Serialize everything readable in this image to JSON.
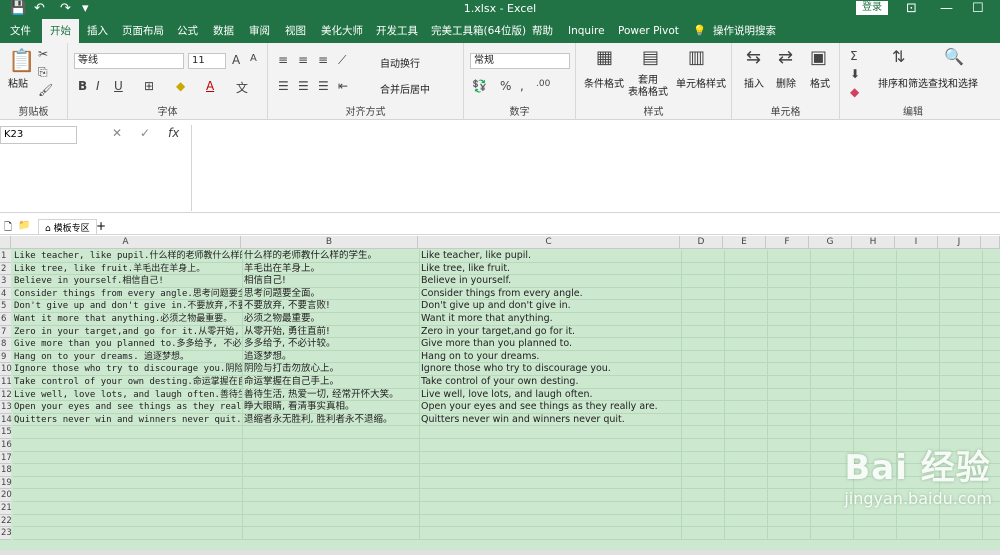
{
  "titlebar": {
    "title": "1.xlsx  -  Excel",
    "login": "登录"
  },
  "tabs": [
    "文件",
    "开始",
    "插入",
    "页面布局",
    "公式",
    "数据",
    "审阅",
    "视图",
    "美化大师",
    "开发工具",
    "完美工具箱(64位版)",
    "帮助",
    "Inquire",
    "Power Pivot",
    "操作说明搜索"
  ],
  "ribbon": {
    "clipboard": {
      "paste": "粘贴",
      "label": "剪贴板"
    },
    "font": {
      "name": "等线",
      "size": "11",
      "bold": "B",
      "italic": "I",
      "underline": "U",
      "label": "字体"
    },
    "align": {
      "wrap": "自动换行",
      "merge": "合并后居中",
      "label": "对齐方式"
    },
    "number": {
      "format": "常规",
      "label": "数字"
    },
    "styles": {
      "cond": "条件格式",
      "table": "套用\n表格格式",
      "cellstyle": "单元格样式",
      "label": "样式"
    },
    "cells": {
      "insert": "插入",
      "delete": "删除",
      "format": "格式",
      "label": "单元格"
    },
    "edit": {
      "sort": "排序和筛选",
      "find": "查找和选择",
      "label": "编辑"
    }
  },
  "formula_bar": {
    "namebox": "K23",
    "fx": "fx",
    "value": ""
  },
  "doc_tabs": {
    "template": "模板专区",
    "add": "+"
  },
  "columns": [
    "A",
    "B",
    "C",
    "D",
    "E",
    "F",
    "G",
    "H",
    "I",
    "J"
  ],
  "rows": [
    [
      "Like teacher, like pupil.什么样的老师教什么样的",
      "什么样的老师教什么样的学生。",
      "Like teacher, like pupil."
    ],
    [
      "Like tree, like fruit.羊毛出在羊身上。",
      "羊毛出在羊身上。",
      "Like tree, like fruit."
    ],
    [
      "Believe in yourself.相信自己!",
      "相信自己!",
      "Believe in yourself."
    ],
    [
      "Consider things from every angle.思考问题要全面",
      "思考问题要全面。",
      "Consider things from every angle."
    ],
    [
      "Don't give up and don't give in.不要放弃,不要",
      "不要放弃, 不要言败!",
      "Don't give up and don't give in."
    ],
    [
      "Want it more that anything.必须之物最重要。",
      "必须之物最重要。",
      "Want it more that anything."
    ],
    [
      "Zero in your target,and go for it.从零开始, 勇",
      "从零开始, 勇往直前!",
      "Zero in your target,and go for it."
    ],
    [
      "Give more than you planned to.多多给予, 不必计",
      "多多给予, 不必计较。",
      "Give more than you planned to."
    ],
    [
      "Hang on to your dreams. 追逐梦想。",
      " 追逐梦想。",
      "Hang on to your dreams."
    ],
    [
      "Ignore those who try to discourage you.阴险与",
      "阴险与打击勿放心上。",
      "Ignore those who try to discourage you."
    ],
    [
      "Take control of your own desting.命运掌握在自",
      "命运掌握在自己手上。",
      "Take control of your own desting."
    ],
    [
      "Live well, love lots, and laugh often.善待生活",
      "善待生活, 热爱一切, 经常开怀大笑。",
      "Live well, love lots, and laugh often."
    ],
    [
      "Open your eyes and see things as they really",
      "睁大眼睛, 看清事实真相。",
      "Open your eyes and see things as they really are."
    ],
    [
      "Quitters never win and winners never quit.退缩",
      "退缩者永无胜利, 胜利者永不退缩。",
      "Quitters never win and winners never quit."
    ]
  ],
  "row_count": 23,
  "watermark": {
    "brand": "Bai 经验",
    "url": "jingyan.baidu.com"
  }
}
